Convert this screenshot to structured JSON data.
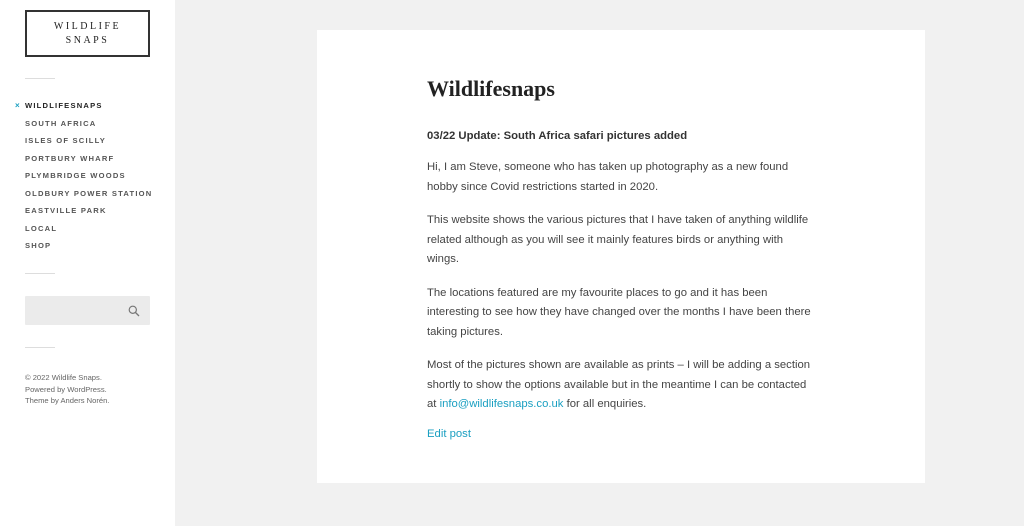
{
  "site": {
    "logo_line1": "WILDLIFE",
    "logo_line2": "SNAPS"
  },
  "nav": {
    "items": [
      {
        "label": "WILDLIFESNAPS",
        "active": true
      },
      {
        "label": "SOUTH AFRICA"
      },
      {
        "label": "ISLES OF SCILLY"
      },
      {
        "label": "PORTBURY WHARF"
      },
      {
        "label": "PLYMBRIDGE WOODS"
      },
      {
        "label": "OLDBURY POWER STATION"
      },
      {
        "label": "EASTVILLE PARK"
      },
      {
        "label": "LOCAL"
      },
      {
        "label": "SHOP"
      }
    ],
    "active_mark": "×",
    "accent": "#1a9fc1"
  },
  "search": {
    "value": "",
    "icon": "search-icon"
  },
  "credits": {
    "line1": "© 2022 Wildlife Snaps.",
    "line2": "Powered by WordPress.",
    "line3": "Theme by Anders Norén."
  },
  "post": {
    "title": "Wildlifesnaps",
    "update": "03/22 Update: South Africa safari pictures added",
    "p1": "Hi, I am Steve, someone who has taken up photography as a new found hobby since Covid restrictions started in 2020.",
    "p2": "This website shows the various pictures that I have taken of anything wildlife related although as you will see it mainly features birds or anything with wings.",
    "p3": "The locations featured are my favourite places to go and it has been interesting to see how they have changed over the months I have been there taking pictures.",
    "p4_before": "Most of the pictures shown are available as prints – I will be adding a section shortly to show the options available but in the meantime I can be contacted at ",
    "p4_link": "info@wildlifesnaps.co.uk",
    "p4_after": " for all enquiries.",
    "edit_label": "Edit post"
  }
}
